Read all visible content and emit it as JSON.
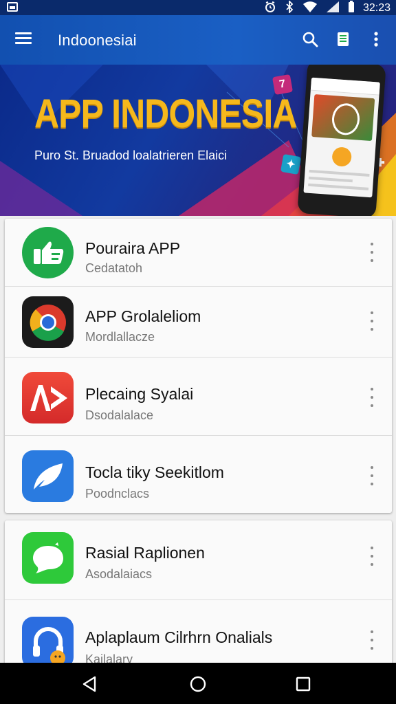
{
  "status_bar": {
    "time": "32:23"
  },
  "app_bar": {
    "title": "Indoonesiai"
  },
  "banner": {
    "headline": "APP INDONESIA",
    "tagline": "Puro St. Bruadod loalatrieren Elaici"
  },
  "lists": [
    {
      "items": [
        {
          "name": "Pouraira APP",
          "subtitle": "Cedatatoh",
          "icon": "thumbs-up-icon",
          "color": "#1faa4a"
        },
        {
          "name": "APP Grolaleliom",
          "subtitle": "Mordlallacze",
          "icon": "chrome-icon",
          "color": "#1b1b1b"
        },
        {
          "name": "Plecaing Syalai",
          "subtitle": "Dsodalalace",
          "icon": "ad-play-icon",
          "color": "#e53a34"
        },
        {
          "name": "Tocla tiky Seekitlom",
          "subtitle": "Poodnclacs",
          "icon": "leaf-bird-icon",
          "color": "#2a7be0"
        }
      ]
    },
    {
      "items": [
        {
          "name": "Rasial Raplionen",
          "subtitle": "Asodalaiacs",
          "icon": "chat-bubble-icon",
          "color": "#2ec93a"
        },
        {
          "name": "Aplaplaum Cilrhrn Onalials",
          "subtitle": "Kailalary",
          "icon": "headphones-icon",
          "color": "#2b6de0"
        }
      ]
    }
  ],
  "colors": {
    "app_bar": "#1a5fc4",
    "headline": "#f5b81c",
    "nav_bar": "#000000"
  }
}
